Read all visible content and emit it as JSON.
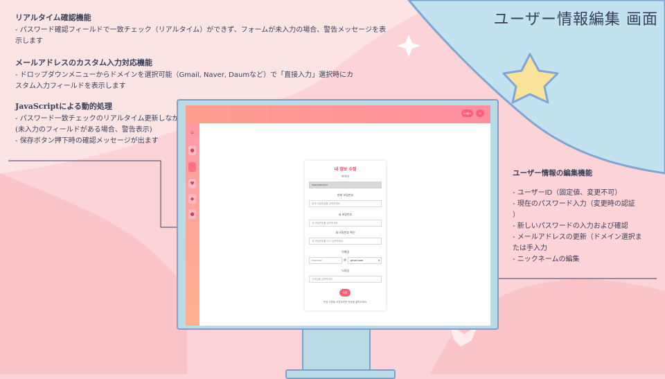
{
  "page_title": "ユーザー情報編集 画面",
  "notes_left": [
    {
      "title": "リアルタイム確認機能",
      "text": "- パスワード確認フィールドで一致チェック（リアルタイム）ができず、フォームが未入力の場合、警告メッセージを表\n示します"
    },
    {
      "title": "メールアドレスのカスタム入力対応機能",
      "text": "- ドロップダウンメニューからドメインを選択可能（Gmail, Naver, Daumなど）で「直接入力」選択時にカ\nスタム入力フィールドを表示します"
    },
    {
      "title": "JavaScriptによる動的処理",
      "text": "- パスワード一致チェックのリアルタイム更新しながら入力必須チェック\n(未入力のフィールドがある場合、警告表示)\n- 保存ボタン押下時の確認メッセージが出ます"
    }
  ],
  "note_right": {
    "title": "ユーザー情報の編集機能",
    "text": "- ユーザーID（固定値、変更不可）\n- 現在のパスワード入力（変更時の認証\n）\n- 新しいパスワードの入力および確認\n- メールアドレスの更新（ドメイン選択ま\nたは手入力\n- ニックネームの編集"
  },
  "app": {
    "header_login": "Login",
    "card": {
      "title": "내 정보 수정",
      "id_label": "아이디",
      "id_value": "exampleUser",
      "current_pw_label": "현재 비밀번호",
      "current_pw_placeholder": "현재 비밀번호를 입력하세요",
      "new_pw_label": "새 비밀번호",
      "new_pw_placeholder": "새 비밀번호를 입력하세요",
      "confirm_pw_label": "새 비밀번호 확인",
      "confirm_pw_placeholder": "새 비밀번호를 다시 입력하세요",
      "email_label": "이메일",
      "email_local": "example",
      "email_at": "@",
      "email_domain": "gmail.com",
      "nickname_label": "닉네임",
      "nickname_placeholder": "닉네임을 입력하세요",
      "save_label": "저장",
      "footer_note": "변경 사항을 저장하려면 저장을 클릭하세요."
    }
  },
  "colors": {
    "accent": "#ff5f7b",
    "text_dark": "#3a3f5a",
    "monitor": "#b9dbe6"
  }
}
